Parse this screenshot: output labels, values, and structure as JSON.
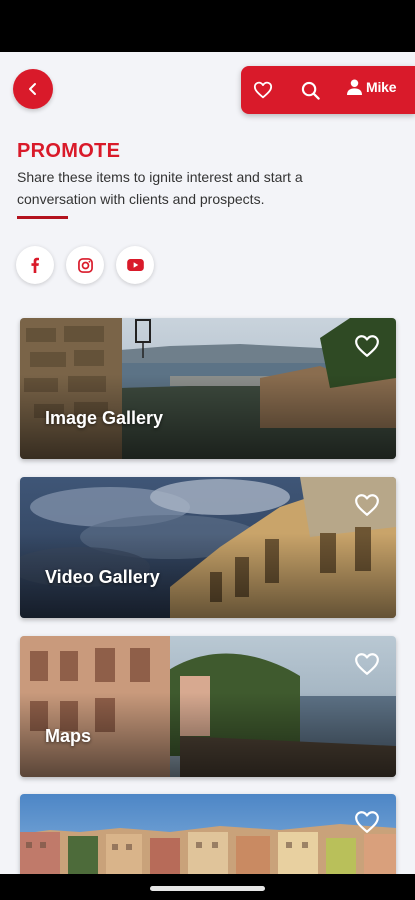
{
  "header": {
    "user_name": "Mike"
  },
  "section": {
    "title": "PROMOTE",
    "description": "Share these items to ignite interest and start a conversation with clients and prospects."
  },
  "social": [
    "facebook-icon",
    "instagram-icon",
    "youtube-icon"
  ],
  "cards": [
    {
      "label": "Image Gallery"
    },
    {
      "label": "Video Gallery"
    },
    {
      "label": "Maps"
    },
    {
      "label": ""
    }
  ],
  "colors": {
    "accent": "#d91a2a",
    "background": "#f3f4f8",
    "rule": "#b3131f"
  }
}
